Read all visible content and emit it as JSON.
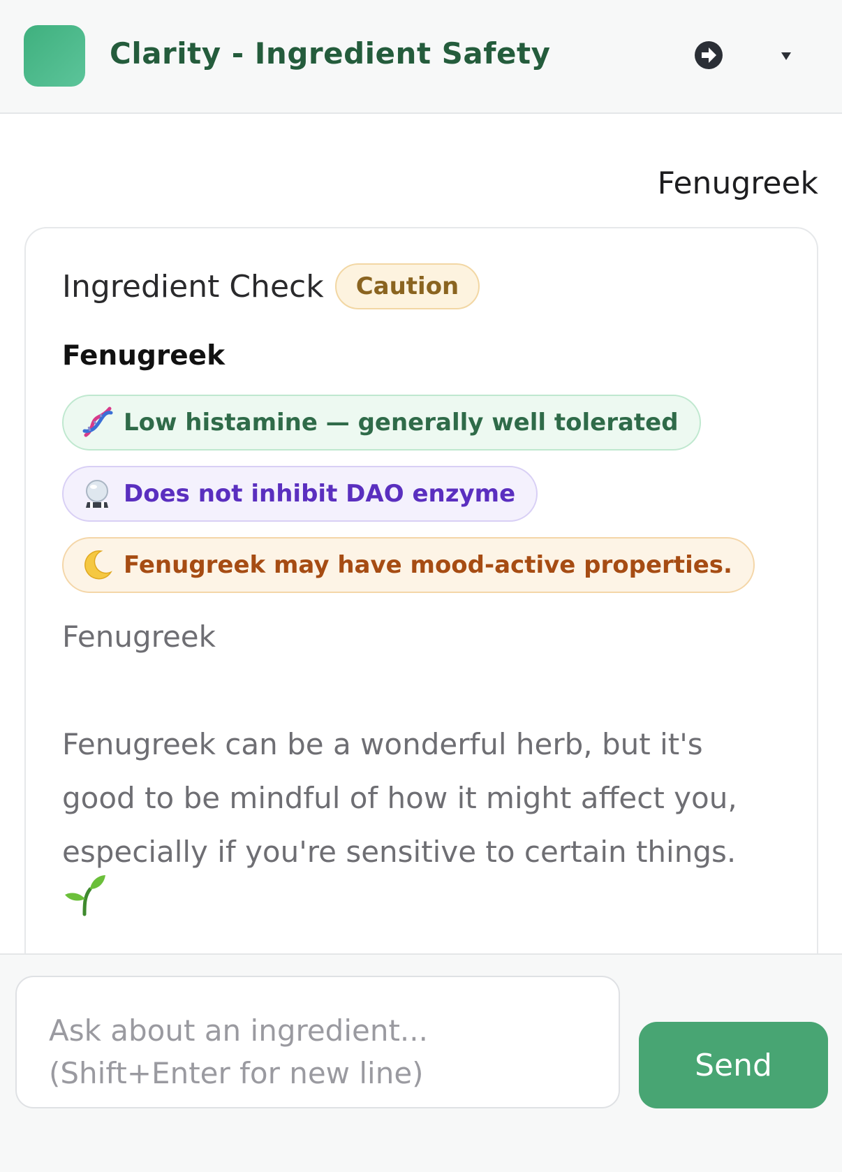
{
  "header": {
    "title": "Clarity - Ingredient Safety",
    "logo_color": "#4fbb8a",
    "actions": [
      {
        "icon": "arrow-circle-right-icon"
      },
      {
        "icon": "dropdown-triangle-icon"
      }
    ]
  },
  "conversation": {
    "user_message": "Fenugreek",
    "response_card": {
      "title": "Ingredient Check",
      "badge": "Caution",
      "badge_color": "#8a6420",
      "ingredient_name": "Fenugreek",
      "tags": [
        {
          "icon": "dna-icon",
          "text": "Low histamine — generally well tolerated",
          "color": "#2f6b49"
        },
        {
          "icon": "crystal-ball-icon",
          "text": "Does not inhibit DAO enzyme",
          "color": "#5a2fbf"
        },
        {
          "icon": "crescent-moon-icon",
          "text": "Fenugreek may have mood-active properties.",
          "color": "#a64c13"
        }
      ],
      "subheading": "Fenugreek",
      "body": "Fenugreek can be a wonderful herb, but it's good to be mindful of how it might affect you, especially if you're sensitive to certain things.",
      "trailing_icon": "seedling-icon"
    }
  },
  "composer": {
    "placeholder": "Ask about an ingredient...\n(Shift+Enter for new line)",
    "send_label": "Send",
    "send_color": "#48a573"
  }
}
